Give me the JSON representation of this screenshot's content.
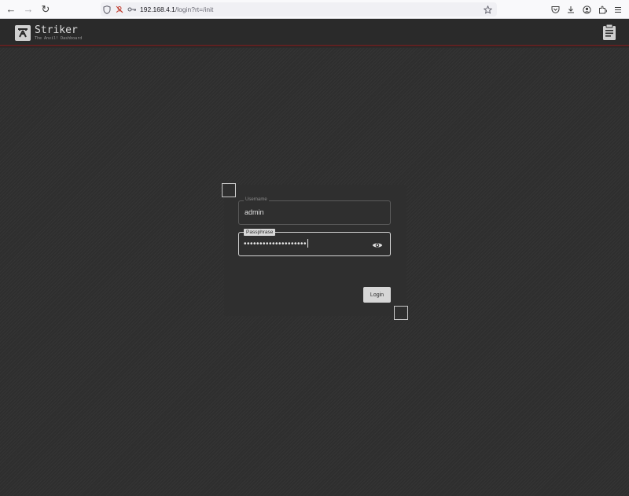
{
  "browser": {
    "url_host": "192.168.4.1",
    "url_path": "/login?rt=/init",
    "icons": [
      "back-icon",
      "forward-icon",
      "reload-icon",
      "shield-icon",
      "permissions-icon",
      "key-icon",
      "star-icon",
      "pocket-icon",
      "download-icon",
      "account-icon",
      "extensions-icon",
      "menu-icon"
    ]
  },
  "header": {
    "title": "Striker",
    "subtitle": "The Anvil! Dashboard",
    "accent_line_color": "#7a1f1f"
  },
  "login": {
    "username_label": "Username",
    "username_value": "admin",
    "passphrase_label": "Passphrase",
    "passphrase_mask": "••••••••••••••••••••",
    "submit_label": "Login"
  }
}
